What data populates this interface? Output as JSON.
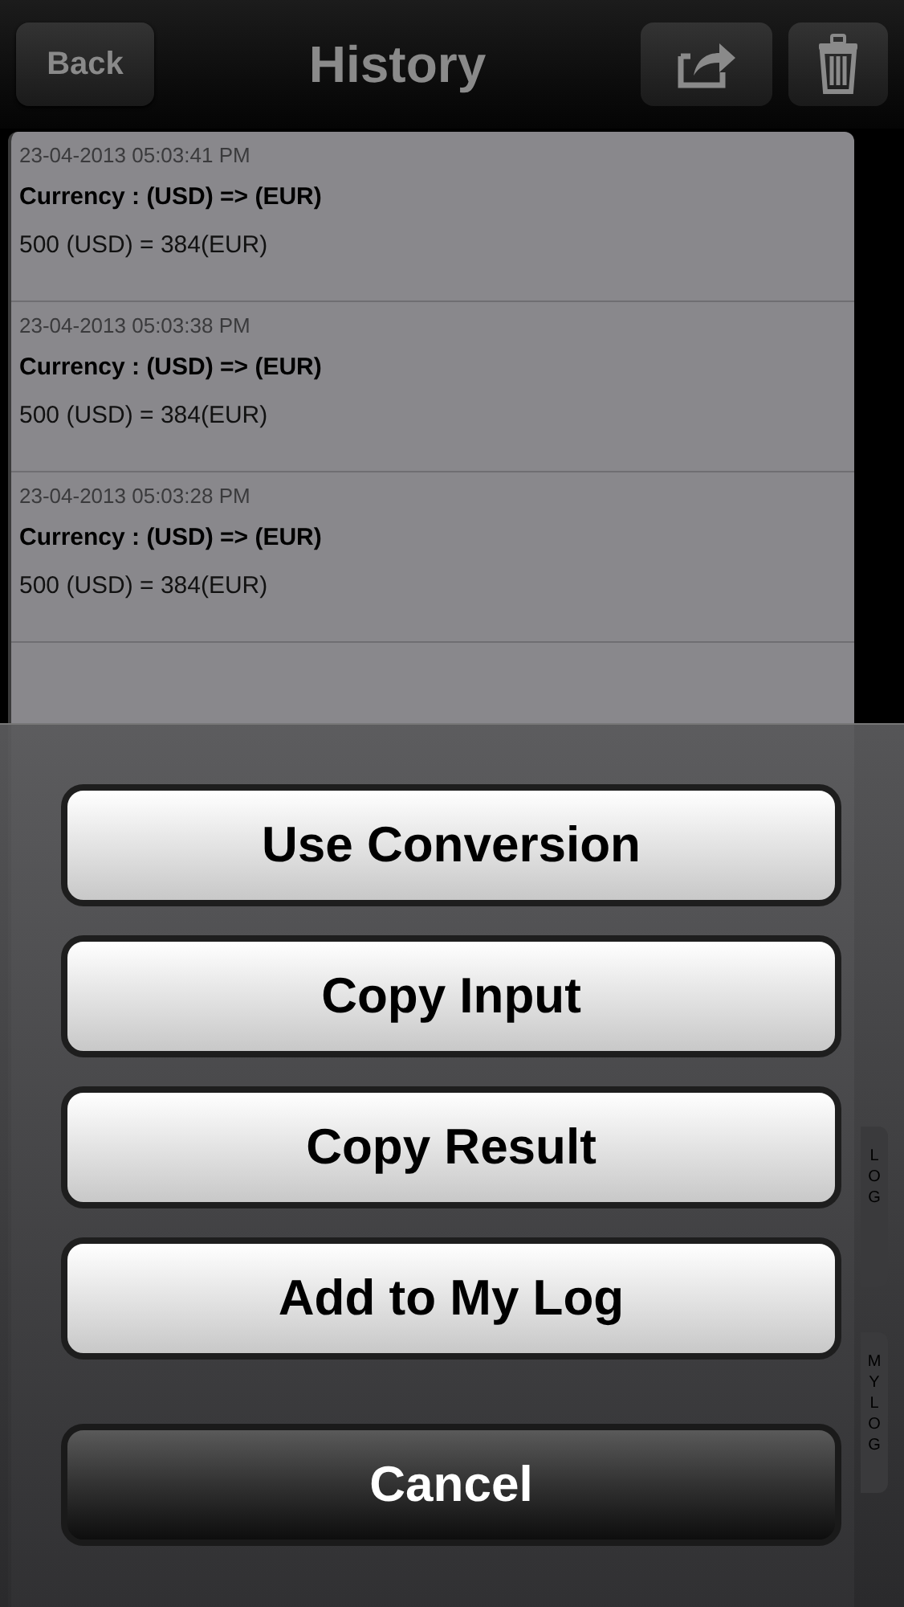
{
  "nav_bar": {
    "back": "Back",
    "title": "History"
  },
  "history": [
    {
      "time": "23-04-2013 05:03:41 PM",
      "heading": "Currency : (USD) => (EUR)",
      "result": "500 (USD) = 384(EUR)"
    },
    {
      "time": "23-04-2013 05:03:38 PM",
      "heading": "Currency : (USD) => (EUR)",
      "result": "500 (USD) = 384(EUR)"
    },
    {
      "time": "23-04-2013 05:03:28 PM",
      "heading": "Currency : (USD) => (EUR)",
      "result": "500 (USD) = 384(EUR)"
    }
  ],
  "action_sheet": [
    {
      "label": "Use Conversion",
      "kind": "default"
    },
    {
      "label": "Copy Input",
      "kind": "default"
    },
    {
      "label": "Copy Result",
      "kind": "default"
    },
    {
      "label": "Add to My Log",
      "kind": "default"
    },
    {
      "label": "Cancel",
      "kind": "cancel"
    }
  ],
  "side_tabs": [
    "LOG",
    "MY LOG"
  ]
}
